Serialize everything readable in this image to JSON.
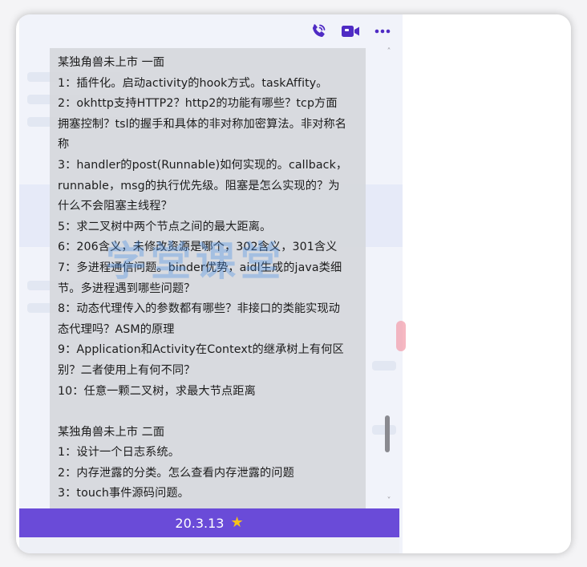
{
  "toolbar": {
    "icons": [
      "phone-call-icon",
      "video-call-icon",
      "more-options-icon"
    ],
    "accent": "#5b32c8"
  },
  "message": {
    "lines": [
      "某独角兽未上市 一面",
      "1：插件化。启动activity的hook方式。taskAffity。",
      "2：okhttp支持HTTP2？http2的功能有哪些？tcp方面",
      "拥塞控制？tsl的握手和具体的非对称加密算法。非对称名",
      "称",
      "3：handler的post(Runnable)如何实现的。callback，",
      "runnable，msg的执行优先级。阻塞是怎么实现的？为",
      "什么不会阻塞主线程？",
      "5：求二叉树中两个节点之间的最大距离。",
      "6：206含义，未修改资源是哪个，302含义，301含义",
      "7：多进程通信问题。binder优势，aidl生成的java类细",
      "节。多进程遇到哪些问题？",
      "8：动态代理传入的参数都有哪些？非接口的类能实现动",
      "态代理吗？ASM的原理",
      "9：Application和Activity在Context的继承树上有何区",
      "别？二者使用上有何不同？",
      "10：任意一颗二叉树，求最大节点距离",
      "",
      "某独角兽未上市 二面",
      "1：设计一个日志系统。",
      "2：内存泄露的分类。怎么查看内存泄露的问题",
      "3：touch事件源码问题。"
    ]
  },
  "watermark": "学堂课堂",
  "date_bar": {
    "text": "20.3.13",
    "icon": "star-icon",
    "background": "#6a4bd8",
    "star_color": "#f6c21a"
  },
  "scrollbar": {
    "up": "˄",
    "down": "˅"
  }
}
